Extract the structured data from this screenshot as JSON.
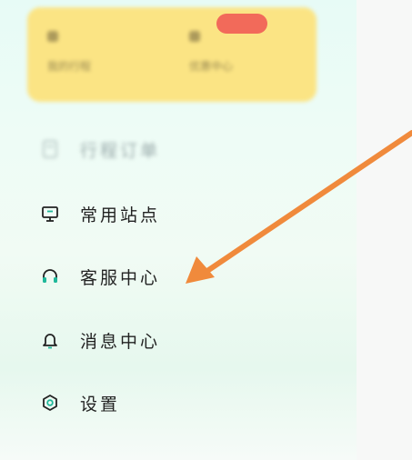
{
  "card": {
    "left_label": "我的行程",
    "right_label": "优惠中心"
  },
  "menu": {
    "items": [
      {
        "label": "行程订单",
        "icon": "document-icon"
      },
      {
        "label": "常用站点",
        "icon": "monitor-icon"
      },
      {
        "label": "客服中心",
        "icon": "headset-icon"
      },
      {
        "label": "消息中心",
        "icon": "bell-icon"
      },
      {
        "label": "设置",
        "icon": "settings-icon"
      }
    ]
  },
  "colors": {
    "card": "#fbe484",
    "badge": "#f26a5a",
    "arrow": "#f08a3c",
    "icon_accent": "#1fb89a"
  }
}
